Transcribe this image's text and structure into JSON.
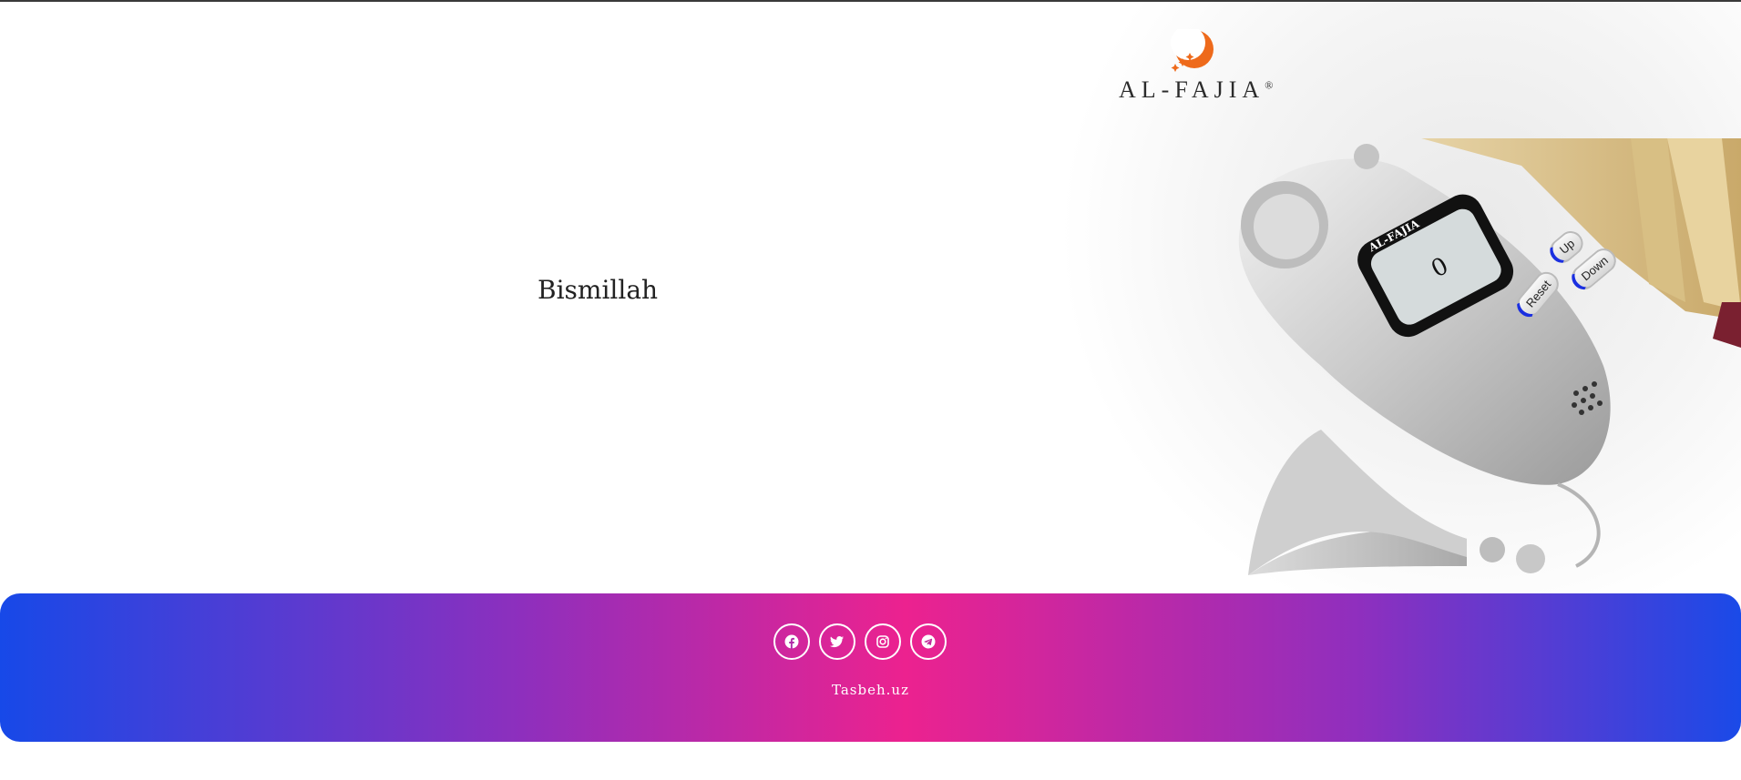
{
  "header": {
    "logo_text": "AL-FAJIA",
    "logo_registered": "®"
  },
  "main": {
    "dhikr_text": "Bismillah"
  },
  "counter": {
    "brand": "AL-FAJIA",
    "display_value": "0",
    "up_label": "Up",
    "down_label": "Down",
    "reset_label": "Reset"
  },
  "footer": {
    "socials": [
      {
        "name": "facebook-icon"
      },
      {
        "name": "twitter-icon"
      },
      {
        "name": "instagram-icon"
      },
      {
        "name": "telegram-icon"
      }
    ],
    "site_name": "Tasbeh.uz"
  },
  "colors": {
    "footer_gradient": [
      "#1749e8",
      "#ec228f",
      "#1a4ae8"
    ],
    "button_accent": "#1a2fe0",
    "logo_orange": "#ee6a1b"
  }
}
